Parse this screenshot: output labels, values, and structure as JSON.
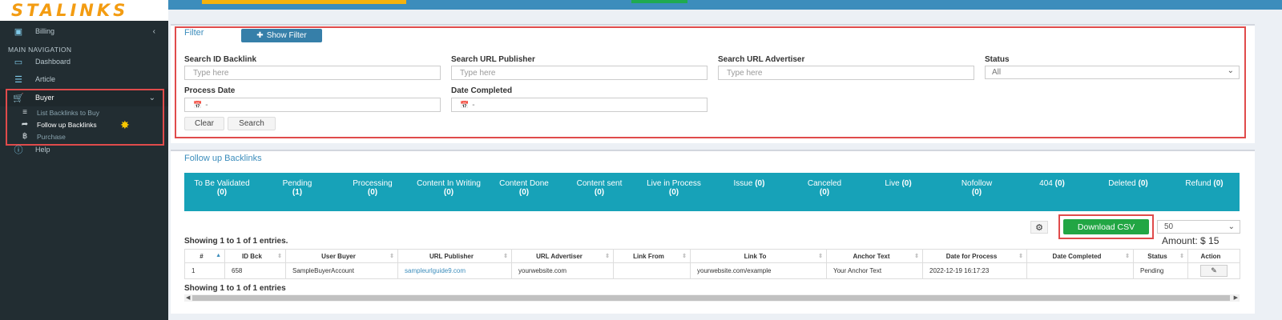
{
  "brand": "STALINKS",
  "sidebar": {
    "billing": "Billing",
    "section_header": "MAIN NAVIGATION",
    "dashboard": "Dashboard",
    "article": "Article",
    "buyer": "Buyer",
    "sub_items": [
      "List Backlinks to Buy",
      "Follow up Backlinks",
      "Purchase"
    ],
    "help": "Help"
  },
  "filter": {
    "title": "Filter",
    "show_filter": "Show Filter",
    "labels": {
      "search_id": "Search ID Backlink",
      "search_publisher": "Search URL Publisher",
      "search_advertiser": "Search URL Advertiser",
      "status": "Status",
      "process_date": "Process Date",
      "date_completed": "Date Completed"
    },
    "placeholder": "Type here",
    "status_value": "All",
    "date_placeholder": "-",
    "clear": "Clear",
    "search": "Search"
  },
  "follow": {
    "title": "Follow up Backlinks",
    "statuses": [
      {
        "label": "To Be Validated",
        "count": "(0)"
      },
      {
        "label": "Pending",
        "count": "(1)"
      },
      {
        "label": "Processing",
        "count": "(0)"
      },
      {
        "label": "Content In Writing",
        "count": "(0)"
      },
      {
        "label": "Content Done",
        "count": "(0)"
      },
      {
        "label": "Content sent",
        "count": "(0)"
      },
      {
        "label": "Live in Process",
        "count": "(0)"
      },
      {
        "label": "Issue",
        "count": "(0)"
      },
      {
        "label": "Canceled",
        "count": "(0)"
      },
      {
        "label": "Live",
        "count": "(0)"
      },
      {
        "label": "Nofollow",
        "count": "(0)"
      },
      {
        "label": "404",
        "count": "(0)"
      },
      {
        "label": "Deleted",
        "count": "(0)"
      },
      {
        "label": "Refund",
        "count": "(0)"
      }
    ],
    "download_csv": "Download CSV",
    "per_page": "50",
    "showing_top": "Showing 1 to 1 of 1 entries.",
    "amount": "Amount: $ 15",
    "showing_bottom": "Showing 1 to 1 of 1 entries",
    "columns": [
      "#",
      "ID Bck",
      "User Buyer",
      "URL Publisher",
      "URL Advertiser",
      "Link From",
      "Link To",
      "Anchor Text",
      "Date for Process",
      "Date Completed",
      "Status",
      "Action"
    ],
    "rows": [
      [
        "1",
        "658",
        "SampleBuyerAccount",
        "sampleurlguide9.com",
        "yourwebsite.com",
        "",
        "yourwebsite.com/example",
        "Your Anchor Text",
        "2022-12-19 16:17:23",
        "",
        "Pending",
        ""
      ]
    ]
  }
}
